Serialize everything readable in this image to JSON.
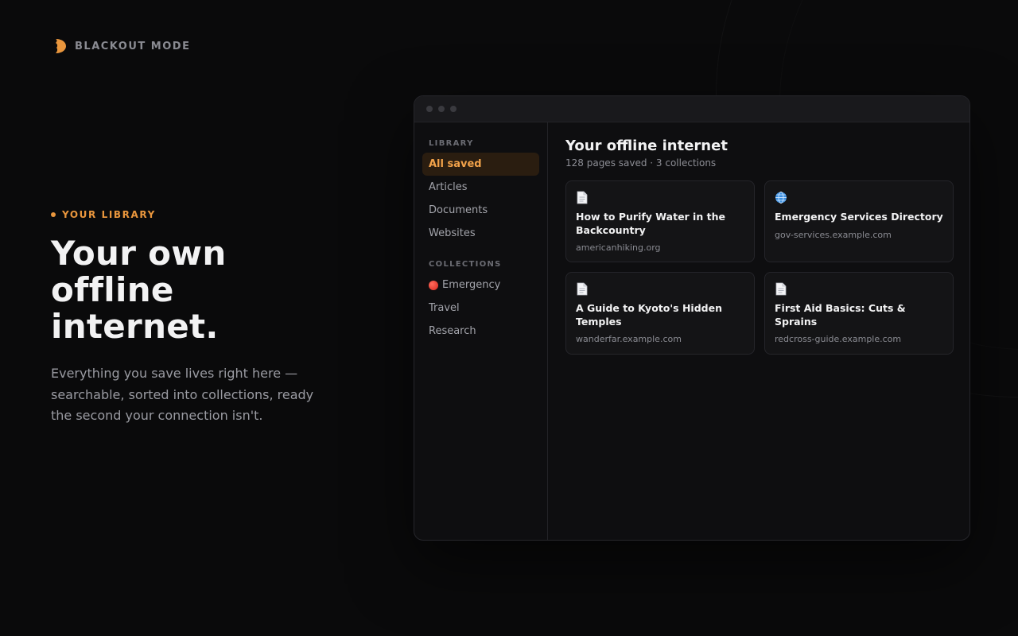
{
  "brand": {
    "name": "BLACKOUT MODE",
    "icon": "moon-bite-icon",
    "accent": "#e9963d"
  },
  "hero": {
    "eyebrow": "YOUR LIBRARY",
    "title": "Your own offline internet.",
    "description": "Everything you save lives right here — searchable, sorted into collections, ready the second your connection isn't."
  },
  "window": {
    "sidebar": {
      "library_heading": "LIBRARY",
      "library_items": [
        {
          "label": "All saved",
          "active": true
        },
        {
          "label": "Articles",
          "active": false
        },
        {
          "label": "Documents",
          "active": false
        },
        {
          "label": "Websites",
          "active": false
        }
      ],
      "collections_heading": "COLLECTIONS",
      "collection_items": [
        {
          "label": "Emergency",
          "icon": "red-circle-icon"
        },
        {
          "label": "Travel"
        },
        {
          "label": "Research"
        }
      ]
    },
    "main": {
      "title": "Your offline internet",
      "subtitle": "128 pages saved · 3 collections",
      "cards": [
        {
          "icon": "document-icon",
          "title": "How to Purify Water in the Backcountry",
          "url": "americanhiking.org"
        },
        {
          "icon": "globe-icon",
          "title": "Emergency Services Directory",
          "url": "gov-services.example.com"
        },
        {
          "icon": "document-icon",
          "title": "A Guide to Kyoto's Hidden Temples",
          "url": "wanderfar.example.com"
        },
        {
          "icon": "document-icon",
          "title": "First Aid Basics: Cuts & Sprains",
          "url": "redcross-guide.example.com"
        }
      ]
    }
  },
  "colors": {
    "background": "#0a0a0b",
    "accent": "#e9963d",
    "active_text": "#f2a24a"
  }
}
